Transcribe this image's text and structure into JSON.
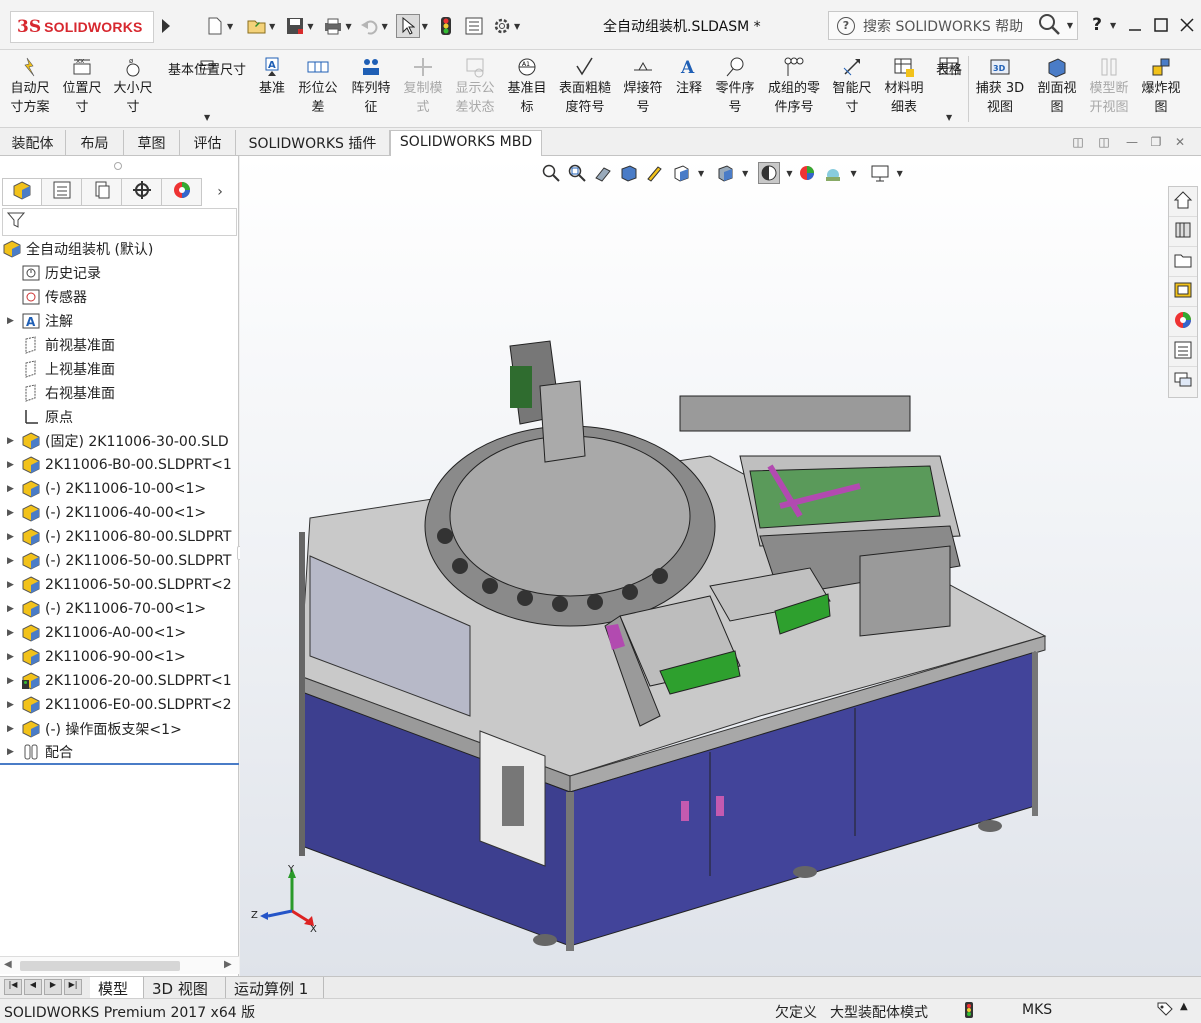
{
  "app": {
    "logo_ds": "3S",
    "logo_name": "SOLIDWORKS",
    "document_title": "全自动组装机.SLDASM *",
    "search_placeholder": "搜索 SOLIDWORKS 帮助",
    "help_label": "?",
    "brand_color": "#d7282f"
  },
  "quick_access": [
    {
      "name": "new-icon"
    },
    {
      "name": "open-icon"
    },
    {
      "name": "save-icon"
    },
    {
      "name": "print-icon"
    },
    {
      "name": "undo-icon"
    },
    {
      "name": "select-icon"
    },
    {
      "name": "rebuild-icon"
    },
    {
      "name": "file-properties-icon"
    },
    {
      "name": "options-icon"
    }
  ],
  "ribbon": [
    {
      "label": "自动尺\n寸方案",
      "icon": "auto-dimension-icon",
      "disabled": false
    },
    {
      "label": "位置尺\n寸",
      "icon": "location-dimension-icon",
      "disabled": false
    },
    {
      "label": "大小尺\n寸",
      "icon": "size-dimension-icon",
      "disabled": false
    },
    {
      "label": "基本位置尺寸",
      "icon": "basic-location-icon",
      "disabled": false
    },
    {
      "label": "基准",
      "icon": "datum-icon",
      "disabled": false
    },
    {
      "label": "形位公\n差",
      "icon": "geometric-tolerance-icon",
      "disabled": false
    },
    {
      "label": "阵列特\n征",
      "icon": "pattern-feature-icon",
      "disabled": false
    },
    {
      "label": "复制模\n式",
      "icon": "copy-scheme-icon",
      "disabled": true
    },
    {
      "label": "显示公\n差状态",
      "icon": "tolerance-status-icon",
      "disabled": true
    },
    {
      "label": "基准目\n标",
      "icon": "datum-target-icon",
      "disabled": false
    },
    {
      "label": "表面粗糙\n度符号",
      "icon": "surface-finish-icon",
      "disabled": false
    },
    {
      "label": "焊接符\n号",
      "icon": "weld-symbol-icon",
      "disabled": false
    },
    {
      "label": "注释",
      "icon": "note-icon",
      "disabled": false
    },
    {
      "label": "零件序\n号",
      "icon": "balloon-icon",
      "disabled": false
    },
    {
      "label": "成组的零\n件序号",
      "icon": "stacked-balloon-icon",
      "disabled": false
    },
    {
      "label": "智能尺\n寸",
      "icon": "smart-dimension-icon",
      "disabled": false
    },
    {
      "label": "材料明\n细表",
      "icon": "bom-icon",
      "disabled": false
    },
    {
      "label": "表格",
      "icon": "table-icon",
      "disabled": false
    },
    {
      "label": "捕获 3D\n视图",
      "icon": "capture-3d-view-icon",
      "disabled": false
    },
    {
      "label": "剖面视\n图",
      "icon": "section-view-icon",
      "disabled": false
    },
    {
      "label": "模型断\n开视图",
      "icon": "model-break-view-icon",
      "disabled": true
    },
    {
      "label": "爆炸视\n图",
      "icon": "exploded-view-icon",
      "disabled": false
    }
  ],
  "command_tabs": [
    "装配体",
    "布局",
    "草图",
    "评估",
    "SOLIDWORKS 插件",
    "SOLIDWORKS MBD"
  ],
  "active_command_tab": "SOLIDWORKS MBD",
  "feature_tree": {
    "root": "全自动组装机  (默认)",
    "items": [
      {
        "label": "历史记录",
        "icon": "history-icon",
        "expandable": false
      },
      {
        "label": "传感器",
        "icon": "sensor-icon",
        "expandable": false
      },
      {
        "label": "注解",
        "icon": "annotation-icon",
        "expandable": true
      },
      {
        "label": "前视基准面",
        "icon": "plane-icon",
        "expandable": false
      },
      {
        "label": "上视基准面",
        "icon": "plane-icon",
        "expandable": false
      },
      {
        "label": "右视基准面",
        "icon": "plane-icon",
        "expandable": false
      },
      {
        "label": "原点",
        "icon": "origin-icon",
        "expandable": false
      },
      {
        "label": "(固定) 2K11006-30-00.SLD",
        "icon": "subassembly-icon",
        "expandable": true
      },
      {
        "label": "2K11006-B0-00.SLDPRT<1",
        "icon": "subassembly-icon",
        "expandable": true
      },
      {
        "label": "(-) 2K11006-10-00<1>",
        "icon": "subassembly-icon",
        "expandable": true
      },
      {
        "label": "(-) 2K11006-40-00<1>",
        "icon": "subassembly-icon",
        "expandable": true
      },
      {
        "label": "(-) 2K11006-80-00.SLDPRT",
        "icon": "subassembly-icon",
        "expandable": true
      },
      {
        "label": "(-) 2K11006-50-00.SLDPRT",
        "icon": "subassembly-icon",
        "expandable": true
      },
      {
        "label": "2K11006-50-00.SLDPRT<2",
        "icon": "subassembly-icon",
        "expandable": true
      },
      {
        "label": "(-) 2K11006-70-00<1>",
        "icon": "subassembly-icon",
        "expandable": true
      },
      {
        "label": "2K11006-A0-00<1>",
        "icon": "subassembly-icon",
        "expandable": true
      },
      {
        "label": "2K11006-90-00<1>",
        "icon": "subassembly-icon",
        "expandable": true
      },
      {
        "label": "2K11006-20-00.SLDPRT<1",
        "icon": "subassembly-warning-icon",
        "expandable": true
      },
      {
        "label": "2K11006-E0-00.SLDPRT<2",
        "icon": "subassembly-icon",
        "expandable": true
      },
      {
        "label": "(-) 操作面板支架<1>",
        "icon": "subassembly-icon",
        "expandable": true
      },
      {
        "label": "配合",
        "icon": "mates-icon",
        "expandable": true
      }
    ]
  },
  "triad": {
    "x": "X",
    "y": "Y",
    "z": "Z"
  },
  "bottom_tabs": [
    "模型",
    "3D 视图",
    "运动算例 1"
  ],
  "active_bottom_tab": "模型",
  "status": {
    "product": "SOLIDWORKS Premium 2017 x64 版",
    "definition": "欠定义",
    "mode": "大型装配体模式",
    "units": "MKS"
  }
}
